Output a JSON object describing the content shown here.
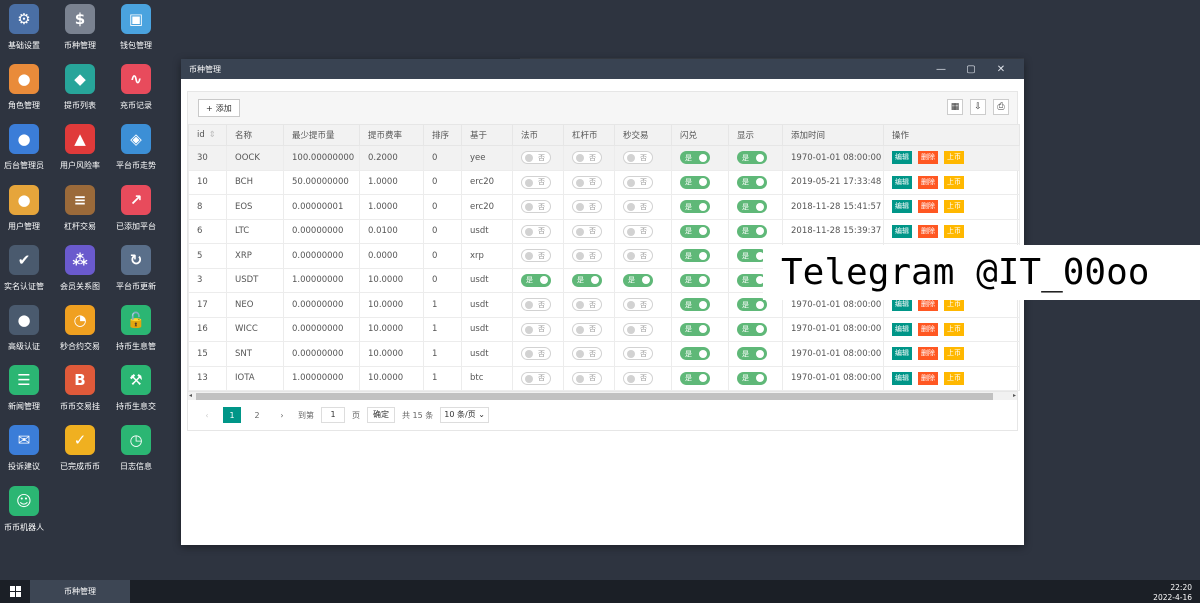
{
  "desktop_icons": [
    {
      "label": "基础设置",
      "icon": "gear-icon",
      "color": "#4a6fa5",
      "glyph": "⚙"
    },
    {
      "label": "币种管理",
      "icon": "dollar-icon",
      "color": "#7a8290",
      "glyph": "$"
    },
    {
      "label": "钱包管理",
      "icon": "wallet-icon",
      "color": "#4aa3df",
      "glyph": "▣"
    },
    {
      "label": "角色管理",
      "icon": "roles-icon",
      "color": "#e98b3a",
      "glyph": "●"
    },
    {
      "label": "提币列表",
      "icon": "withdraw-icon",
      "color": "#27a59a",
      "glyph": "◆"
    },
    {
      "label": "充币记录",
      "icon": "deposit-chart-icon",
      "color": "#e84b5c",
      "glyph": "∿"
    },
    {
      "label": "后台管理员",
      "icon": "admin-user-icon",
      "color": "#3b7dd8",
      "glyph": "●"
    },
    {
      "label": "用户风险率",
      "icon": "alarm-icon",
      "color": "#e03a3a",
      "glyph": "▲"
    },
    {
      "label": "平台币走势",
      "icon": "layers-icon",
      "color": "#3c8fd6",
      "glyph": "◈"
    },
    {
      "label": "用户管理",
      "icon": "user-icon",
      "color": "#e6a53b",
      "glyph": "●"
    },
    {
      "label": "杠杆交易",
      "icon": "stack-icon",
      "color": "#9b6a3a",
      "glyph": "≡"
    },
    {
      "label": "已添加平台",
      "icon": "trend-icon",
      "color": "#e84b5c",
      "glyph": "↗"
    },
    {
      "label": "实名认证管",
      "icon": "id-verify-icon",
      "color": "#4a5a6e",
      "glyph": "✔"
    },
    {
      "label": "会员关系图",
      "icon": "network-icon",
      "color": "#6a5acd",
      "glyph": "⁂"
    },
    {
      "label": "平台币更新",
      "icon": "cloud-refresh-icon",
      "color": "#5a6f8a",
      "glyph": "↻"
    },
    {
      "label": "高级认证",
      "icon": "advanced-verify-icon",
      "color": "#4a5a6e",
      "glyph": "●"
    },
    {
      "label": "秒合约交易",
      "icon": "stopwatch-icon",
      "color": "#f0a020",
      "glyph": "◔"
    },
    {
      "label": "持币生息管",
      "icon": "unlock-icon",
      "color": "#2bb673",
      "glyph": "🔓"
    },
    {
      "label": "新闻管理",
      "icon": "news-icon",
      "color": "#2bb673",
      "glyph": "☰"
    },
    {
      "label": "币币交易挂",
      "icon": "bitcoin-icon",
      "color": "#e05a3a",
      "glyph": "B"
    },
    {
      "label": "持币生息交",
      "icon": "hammer-icon",
      "color": "#2bb673",
      "glyph": "⚒"
    },
    {
      "label": "投诉建议",
      "icon": "feedback-icon",
      "color": "#3b7dd8",
      "glyph": "✉"
    },
    {
      "label": "已完成币币",
      "icon": "check-box-icon",
      "color": "#f0b020",
      "glyph": "✓"
    },
    {
      "label": "日志信息",
      "icon": "log-icon",
      "color": "#2bb673",
      "glyph": "◷"
    },
    {
      "label": "币币机器人",
      "icon": "robot-icon",
      "color": "#2bb673",
      "glyph": "☺"
    }
  ],
  "window": {
    "title": "币种管理",
    "minimize": "—",
    "maximize": "▢",
    "close": "✕"
  },
  "toolbar": {
    "add_label": "添加",
    "add_icon_glyph": "+",
    "columns_glyph": "▦",
    "export_glyph": "⇩",
    "print_glyph": "⎙"
  },
  "table": {
    "headers": [
      "id",
      "名称",
      "最少提币量",
      "提币费率",
      "排序",
      "基于",
      "法币",
      "杠杆币",
      "秒交易",
      "闪兑",
      "显示",
      "添加时间",
      "操作"
    ],
    "sort_glyph": "⇕",
    "switch_on": "是",
    "switch_off": "否",
    "op_edit": "编辑",
    "op_delete": "删除",
    "op_list": "上币",
    "rows": [
      {
        "id": "30",
        "name": "OOCK",
        "min": "100.00000000",
        "fee": "0.2000",
        "sort": "0",
        "base": "yee",
        "fiat": false,
        "lever": false,
        "second": false,
        "flash": true,
        "show": true,
        "time": "1970-01-01 08:00:00"
      },
      {
        "id": "10",
        "name": "BCH",
        "min": "50.00000000",
        "fee": "1.0000",
        "sort": "0",
        "base": "erc20",
        "fiat": false,
        "lever": false,
        "second": false,
        "flash": true,
        "show": true,
        "time": "2019-05-21 17:33:48"
      },
      {
        "id": "8",
        "name": "EOS",
        "min": "0.00000001",
        "fee": "1.0000",
        "sort": "0",
        "base": "erc20",
        "fiat": false,
        "lever": false,
        "second": false,
        "flash": true,
        "show": true,
        "time": "2018-11-28 15:41:57"
      },
      {
        "id": "6",
        "name": "LTC",
        "min": "0.00000000",
        "fee": "0.0100",
        "sort": "0",
        "base": "usdt",
        "fiat": false,
        "lever": false,
        "second": false,
        "flash": true,
        "show": true,
        "time": "2018-11-28 15:39:37"
      },
      {
        "id": "5",
        "name": "XRP",
        "min": "0.00000000",
        "fee": "0.0000",
        "sort": "0",
        "base": "xrp",
        "fiat": false,
        "lever": false,
        "second": false,
        "flash": true,
        "show": true,
        "time": ""
      },
      {
        "id": "3",
        "name": "USDT",
        "min": "1.00000000",
        "fee": "10.0000",
        "sort": "0",
        "base": "usdt",
        "fiat": true,
        "lever": true,
        "second": true,
        "flash": true,
        "show": true,
        "time": ""
      },
      {
        "id": "17",
        "name": "NEO",
        "min": "0.00000000",
        "fee": "10.0000",
        "sort": "1",
        "base": "usdt",
        "fiat": false,
        "lever": false,
        "second": false,
        "flash": true,
        "show": true,
        "time": "1970-01-01 08:00:00"
      },
      {
        "id": "16",
        "name": "WICC",
        "min": "0.00000000",
        "fee": "10.0000",
        "sort": "1",
        "base": "usdt",
        "fiat": false,
        "lever": false,
        "second": false,
        "flash": true,
        "show": true,
        "time": "1970-01-01 08:00:00"
      },
      {
        "id": "15",
        "name": "SNT",
        "min": "0.00000000",
        "fee": "10.0000",
        "sort": "1",
        "base": "usdt",
        "fiat": false,
        "lever": false,
        "second": false,
        "flash": true,
        "show": true,
        "time": "1970-01-01 08:00:00"
      },
      {
        "id": "13",
        "name": "IOTA",
        "min": "1.00000000",
        "fee": "10.0000",
        "sort": "1",
        "base": "btc",
        "fiat": false,
        "lever": false,
        "second": false,
        "flash": true,
        "show": true,
        "time": "1970-01-01 08:00:00"
      }
    ]
  },
  "pager": {
    "prev": "‹",
    "pages": [
      "1",
      "2"
    ],
    "next": "›",
    "goto_label": "到第",
    "page_input": "1",
    "page_unit": "页",
    "confirm": "确定",
    "total": "共 15 条",
    "page_size": "10 条/页 ⌄"
  },
  "watermark": "Telegram @IT_00oo",
  "taskbar": {
    "task_label": "币种管理",
    "time": "22:20",
    "date": "2022-4-16"
  }
}
